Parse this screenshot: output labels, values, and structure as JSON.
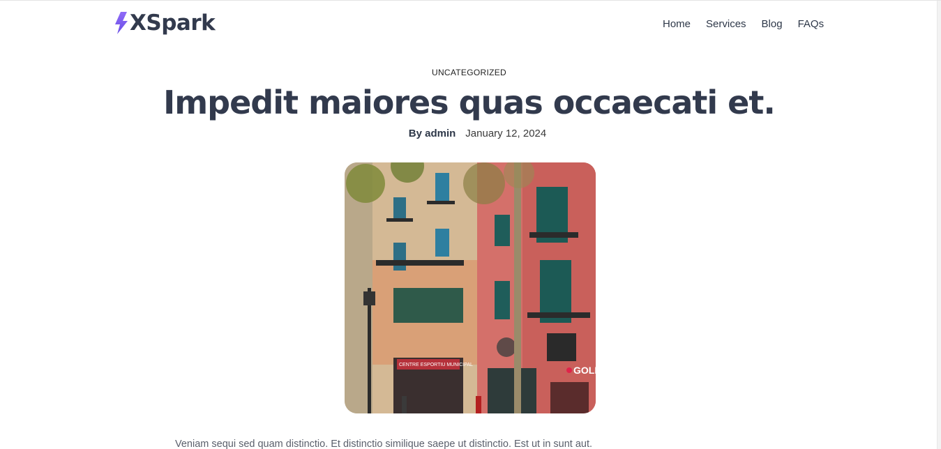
{
  "header": {
    "logo_text": "XSpark",
    "nav": [
      {
        "label": "Home"
      },
      {
        "label": "Services"
      },
      {
        "label": "Blog"
      },
      {
        "label": "FAQs"
      }
    ]
  },
  "post": {
    "category": "UNCATEGORIZED",
    "title": "Impedit maiores quas occaecati et.",
    "author": "By admin",
    "date": "January 12, 2024",
    "excerpt": "Veniam sequi sed quam distinctio. Et distinctio similique saepe ut distinctio. Est ut in sunt aut."
  },
  "image_signs": {
    "left_sign": "CENTRE ESPORTIU MUNICIPAL",
    "right_sign": "GOLL"
  },
  "colors": {
    "logo_bolt": "#7b5cf0",
    "logo_text": "#323a4d",
    "title": "#323a4d"
  },
  "icons": {
    "logo": "lightning-bolt-icon"
  }
}
